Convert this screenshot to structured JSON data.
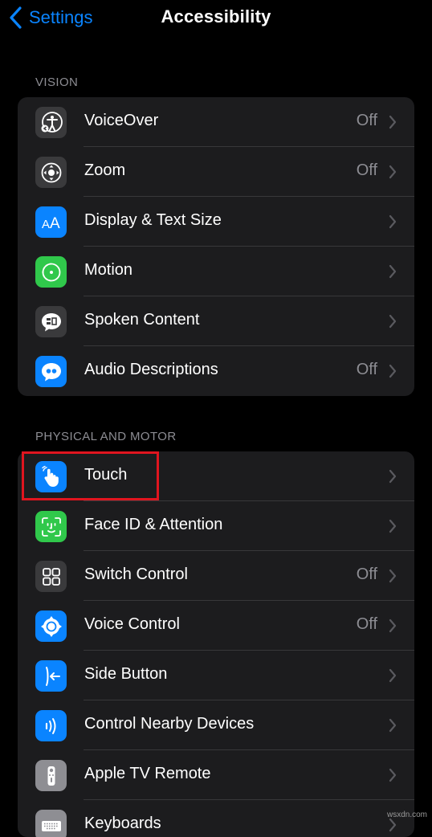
{
  "nav": {
    "back_label": "Settings",
    "title": "Accessibility"
  },
  "sections": [
    {
      "header": "VISION",
      "items": [
        {
          "label": "VoiceOver",
          "value": "Off",
          "icon": "voiceover-icon",
          "icon_color": "#3a3a3c"
        },
        {
          "label": "Zoom",
          "value": "Off",
          "icon": "zoom-icon",
          "icon_color": "#3a3a3c"
        },
        {
          "label": "Display & Text Size",
          "value": "",
          "icon": "text-size-icon",
          "icon_color": "#0a84ff"
        },
        {
          "label": "Motion",
          "value": "",
          "icon": "motion-icon",
          "icon_color": "#30c84b"
        },
        {
          "label": "Spoken Content",
          "value": "",
          "icon": "spoken-content-icon",
          "icon_color": "#3a3a3c"
        },
        {
          "label": "Audio Descriptions",
          "value": "Off",
          "icon": "audio-descriptions-icon",
          "icon_color": "#0a84ff"
        }
      ]
    },
    {
      "header": "PHYSICAL AND MOTOR",
      "items": [
        {
          "label": "Touch",
          "value": "",
          "icon": "touch-hand-icon",
          "icon_color": "#0a84ff"
        },
        {
          "label": "Face ID & Attention",
          "value": "",
          "icon": "face-id-icon",
          "icon_color": "#30c84b"
        },
        {
          "label": "Switch Control",
          "value": "Off",
          "icon": "switch-control-icon",
          "icon_color": "#3a3a3c"
        },
        {
          "label": "Voice Control",
          "value": "Off",
          "icon": "voice-control-icon",
          "icon_color": "#0a84ff"
        },
        {
          "label": "Side Button",
          "value": "",
          "icon": "side-button-icon",
          "icon_color": "#0a84ff"
        },
        {
          "label": "Control Nearby Devices",
          "value": "",
          "icon": "nearby-devices-icon",
          "icon_color": "#0a84ff"
        },
        {
          "label": "Apple TV Remote",
          "value": "",
          "icon": "tv-remote-icon",
          "icon_color": "#8e8e93"
        },
        {
          "label": "Keyboards",
          "value": "",
          "icon": "keyboard-icon",
          "icon_color": "#8e8e93"
        }
      ]
    }
  ],
  "watermark": "wsxdn.com",
  "colors": {
    "accent": "#0a84ff",
    "highlight": "#e0151f"
  }
}
